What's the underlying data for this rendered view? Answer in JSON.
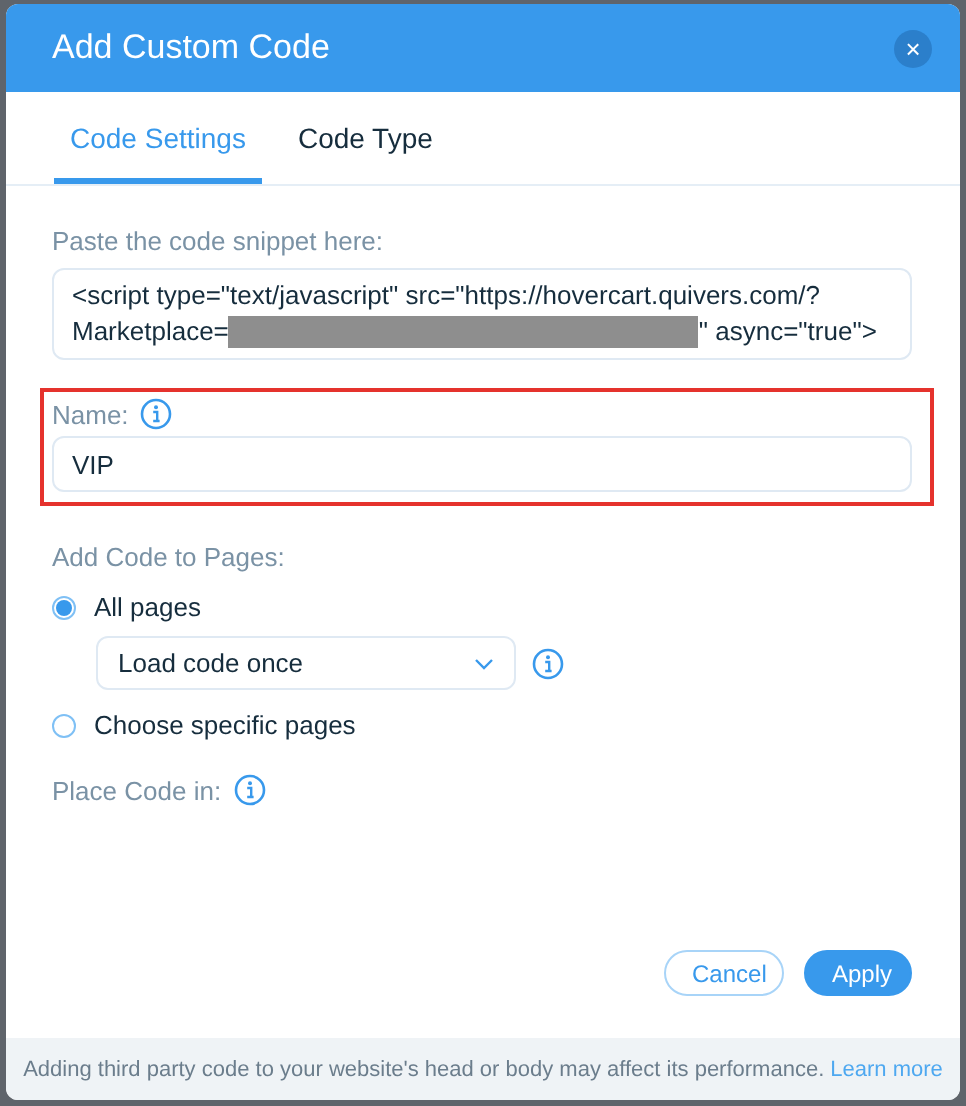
{
  "window": {
    "title": "Add Custom Code",
    "close": "×"
  },
  "tabs": [
    {
      "label": "Code Settings",
      "selected": true
    },
    {
      "label": "Code Type",
      "selected": false
    }
  ],
  "snippet": {
    "label": "Paste the code snippet here:",
    "line1": "<script type=\"text/javascript\" src=\"https://hovercart.quivers.com/?",
    "line2_before": "Marketplace=",
    "redacted": true,
    "line2_after": "\" async=\"true\">"
  },
  "name": {
    "label": "Name:",
    "value": "VIP",
    "highlighted": true
  },
  "pages": {
    "label": "Add Code to Pages:",
    "options": [
      {
        "label": "All pages",
        "selected": true
      },
      {
        "label": "Choose specific pages",
        "selected": false
      }
    ],
    "load_select": {
      "value": "Load code once"
    }
  },
  "place_code": {
    "label": "Place Code in:"
  },
  "buttons": [
    {
      "label": "Cancel",
      "kind": "secondary"
    },
    {
      "label": "Apply",
      "kind": "primary"
    }
  ],
  "footer": {
    "text": "Adding third party code to your website's head or body may affect its performance.",
    "link": "Learn more"
  }
}
